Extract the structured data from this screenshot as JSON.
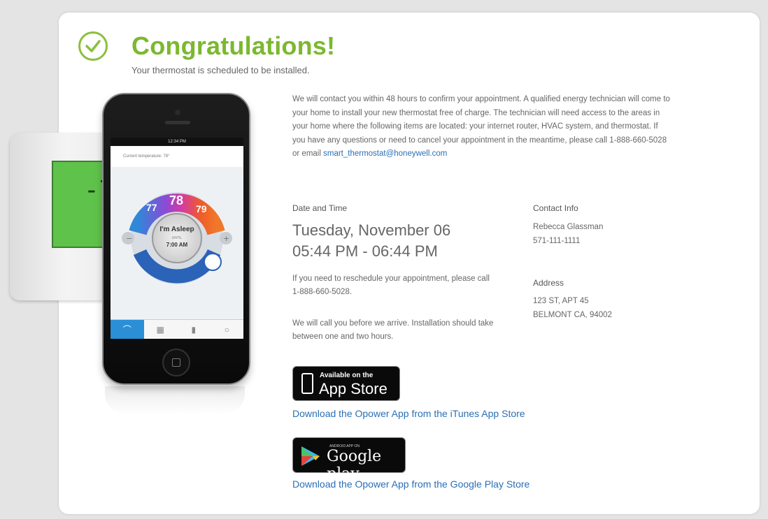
{
  "header": {
    "title": "Congratulations!",
    "subtitle": "Your thermostat is scheduled to be installed."
  },
  "illustration": {
    "thermostat_display": "-78",
    "phone": {
      "status_time": "12:34 PM",
      "current_temperature_label": "Current temperature: 78°",
      "temps": [
        "77",
        "78",
        "79"
      ],
      "mode": "I'm Asleep",
      "until": "UNTIL",
      "until_time": "7:00 AM"
    }
  },
  "intro": {
    "text": "We will contact you within 48 hours to confirm your appointment. A qualified energy technician will come to your home to install your new thermostat free of charge. The technician will need access to the areas in your home where the following items are located: your internet router, HVAC system, and thermostat. If you have any questions or need to cancel your appointment in the meantime, please call 1-888-660-5028 or email ",
    "email": "smart_thermostat@honeywell.com"
  },
  "appointment": {
    "label": "Date and Time",
    "date": "Tuesday, November 06",
    "time": "05:44 PM - 06:44 PM",
    "reschedule": "If you need to reschedule your appointment, please call 1-888-660-5028.",
    "call_note": "We will call you before we arrive. Installation should take between one and two hours."
  },
  "contact": {
    "label": "Contact Info",
    "name": "Rebecca Glassman",
    "phone": "571-111-1111"
  },
  "address": {
    "label": "Address",
    "line1": "123 ST, APT 45",
    "line2": "BELMONT CA, 94002"
  },
  "app_links": {
    "appstore_small": "Available on the",
    "appstore_big": "App Store",
    "appstore_link": "Download the Opower App from the iTunes App Store",
    "gplay_small": "ANDROID APP ON",
    "gplay_big": "Google play",
    "gplay_link": "Download the Opower App from the Google Play Store"
  },
  "colors": {
    "brand_green": "#7cb82f",
    "link_blue": "#2a6fb6"
  }
}
